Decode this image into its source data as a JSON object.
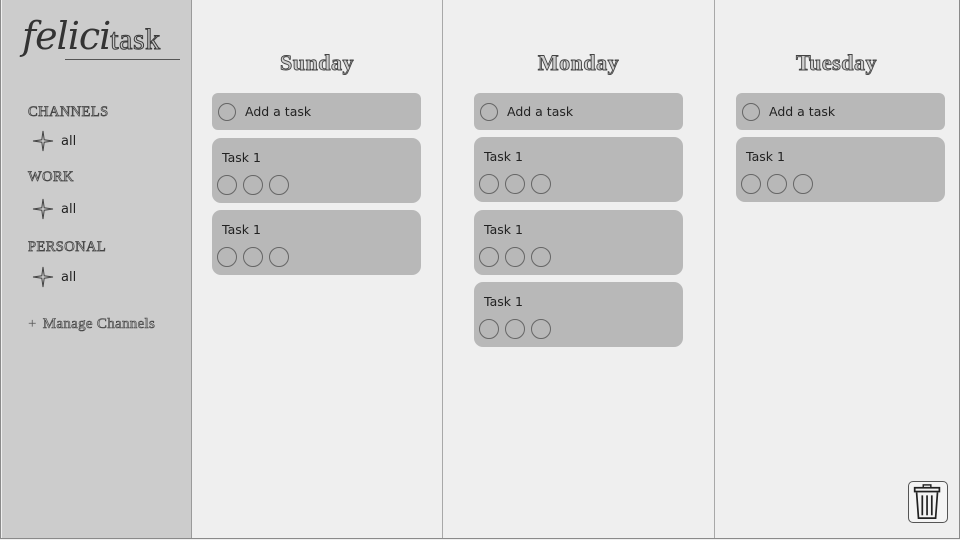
{
  "logo": {
    "part1": "felici",
    "part2": "task"
  },
  "sidebar": {
    "sections": [
      {
        "title": "CHANNELS",
        "item": "all",
        "icon": "sparkle-icon"
      },
      {
        "title": "WORK",
        "item": "all",
        "icon": "sparkle-icon"
      },
      {
        "title": "PERSONAL",
        "item": "all",
        "icon": "sparkle-icon"
      }
    ],
    "manage_plus": "+",
    "manage_label": "Manage Channels"
  },
  "columns": [
    {
      "day": "Sunday",
      "add_label": "Add a task",
      "tasks": [
        "Task 1",
        "Task 1"
      ]
    },
    {
      "day": "Monday",
      "add_label": "Add a task",
      "tasks": [
        "Task 1",
        "Task 1",
        "Task 1"
      ]
    },
    {
      "day": "Tuesday",
      "add_label": "Add a task",
      "tasks": [
        "Task 1"
      ]
    }
  ],
  "trash": {
    "icon": "trash-icon"
  },
  "colors": {
    "background": "#efefef",
    "sidebar": "#cccccc",
    "card": "#b8b8b8"
  }
}
